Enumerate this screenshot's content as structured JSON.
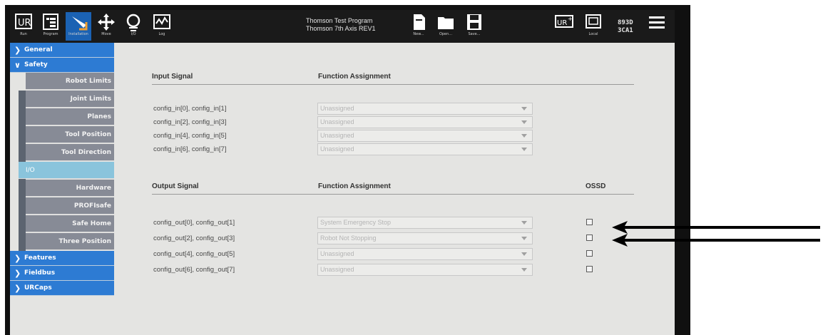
{
  "topbar": {
    "buttons": [
      {
        "name": "run",
        "label": "Run"
      },
      {
        "name": "program",
        "label": "Program"
      },
      {
        "name": "installation",
        "label": "Installation"
      },
      {
        "name": "move",
        "label": "Move"
      },
      {
        "name": "io",
        "label": "I/O"
      },
      {
        "name": "log",
        "label": "Log"
      }
    ],
    "program_title": "Thomson Test Program",
    "installation_title": "Thomson 7th Axis REV1",
    "file_buttons": [
      {
        "name": "new",
        "label": "New..."
      },
      {
        "name": "open",
        "label": "Open..."
      },
      {
        "name": "save",
        "label": "Save..."
      }
    ],
    "local_label": "Local",
    "robot_id_line1": "893D",
    "robot_id_line2": "3CA1"
  },
  "sidebar": {
    "general": "General",
    "safety": "Safety",
    "safety_items": [
      "Robot Limits",
      "Joint Limits",
      "Planes",
      "Tool Position",
      "Tool Direction",
      "I/O",
      "Hardware",
      "PROFIsafe",
      "Safe Home",
      "Three Position"
    ],
    "features": "Features",
    "fieldbus": "Fieldbus",
    "urcaps": "URCaps"
  },
  "main": {
    "input_header": "Input Signal",
    "input_func_header": "Function Assignment",
    "inputs": [
      {
        "signal": "config_in[0], config_in[1]",
        "value": "Unassigned"
      },
      {
        "signal": "config_in[2], config_in[3]",
        "value": "Unassigned"
      },
      {
        "signal": "config_in[4], config_in[5]",
        "value": "Unassigned"
      },
      {
        "signal": "config_in[6], config_in[7]",
        "value": "Unassigned"
      }
    ],
    "output_header": "Output Signal",
    "output_func_header": "Function Assignment",
    "ossd_header": "OSSD",
    "outputs": [
      {
        "signal": "config_out[0], config_out[1]",
        "value": "System Emergency Stop"
      },
      {
        "signal": "config_out[2], config_out[3]",
        "value": "Robot Not Stopping"
      },
      {
        "signal": "config_out[4], config_out[5]",
        "value": "Unassigned"
      },
      {
        "signal": "config_out[6], config_out[7]",
        "value": "Unassigned"
      }
    ]
  }
}
